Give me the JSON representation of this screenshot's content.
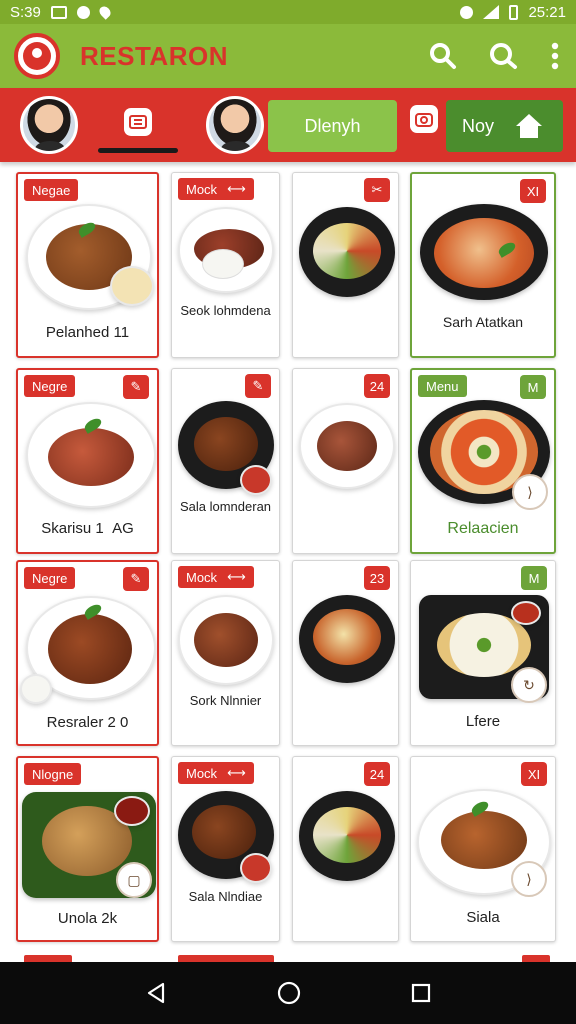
{
  "status_bar": {
    "time_left": "S:39",
    "time_right": "25:21"
  },
  "app": {
    "title": "RESTARON"
  },
  "nav_strip": {
    "button_green": "Dlenyh",
    "button_dark": "Noy"
  },
  "cards": [
    {
      "tag": "Negae",
      "label": "Pelanhed 11",
      "corner": ""
    },
    {
      "tag": "Mock",
      "label": "Seok lohmdena",
      "corner": ""
    },
    {
      "tag": "",
      "label": "",
      "corner": ""
    },
    {
      "tag": "",
      "label": "Sarh Atatkan",
      "corner": "XI"
    },
    {
      "tag": "Negre",
      "label": "Skarisu 1  AG",
      "corner": ""
    },
    {
      "tag": "",
      "label": "Sala lomnderan",
      "corner": ""
    },
    {
      "tag": "",
      "label": "",
      "corner": "24"
    },
    {
      "tag": "Menu",
      "label": "Relaacien",
      "corner": "M"
    },
    {
      "tag": "Negre",
      "label": "Resraler 2 0",
      "corner": ""
    },
    {
      "tag": "Mock",
      "label": "Sork Nlnnier",
      "corner": ""
    },
    {
      "tag": "",
      "label": "",
      "corner": "23"
    },
    {
      "tag": "",
      "label": "Lfere",
      "corner": "M"
    },
    {
      "tag": "Nlogne",
      "label": "Unola 2k",
      "corner": ""
    },
    {
      "tag": "Mock",
      "label": "Sala Nlndiae",
      "corner": ""
    },
    {
      "tag": "",
      "label": "",
      "corner": "24"
    },
    {
      "tag": "",
      "label": "Siala",
      "corner": "XI"
    }
  ]
}
